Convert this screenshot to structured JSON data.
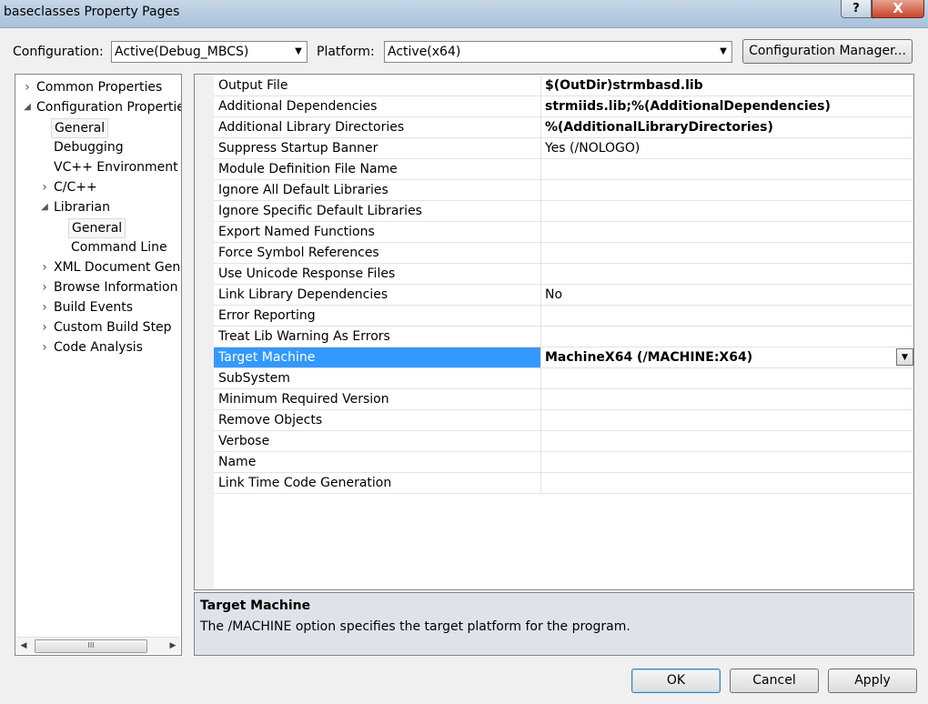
{
  "window": {
    "title": "baseclasses Property Pages",
    "help_label": "?",
    "close_label": "X"
  },
  "toolbar": {
    "configuration_label": "Configuration:",
    "configuration_value": "Active(Debug_MBCS)",
    "platform_label": "Platform:",
    "platform_value": "Active(x64)",
    "config_manager_label": "Configuration Manager..."
  },
  "tree": {
    "items": [
      {
        "label": "Common Properties",
        "expander": "›",
        "level": 0
      },
      {
        "label": "Configuration Propertie",
        "expander": "◢",
        "level": 0
      },
      {
        "label": "General",
        "expander": "",
        "level": 1
      },
      {
        "label": "Debugging",
        "expander": "",
        "level": 1
      },
      {
        "label": "VC++ Environment V",
        "expander": "",
        "level": 1
      },
      {
        "label": "C/C++",
        "expander": "›",
        "level": 1
      },
      {
        "label": "Librarian",
        "expander": "◢",
        "level": 1
      },
      {
        "label": "General",
        "expander": "",
        "level": 2
      },
      {
        "label": "Command Line",
        "expander": "",
        "level": 2
      },
      {
        "label": "XML Document Gene",
        "expander": "›",
        "level": 1
      },
      {
        "label": "Browse Information",
        "expander": "›",
        "level": 1
      },
      {
        "label": "Build Events",
        "expander": "›",
        "level": 1
      },
      {
        "label": "Custom Build Step",
        "expander": "›",
        "level": 1
      },
      {
        "label": "Code Analysis",
        "expander": "›",
        "level": 1
      }
    ],
    "scroll_thumb_label": "III"
  },
  "properties": [
    {
      "name": "Output File",
      "value": "$(OutDir)strmbasd.lib",
      "bold": true
    },
    {
      "name": "Additional Dependencies",
      "value": "strmiids.lib;%(AdditionalDependencies)",
      "bold": true
    },
    {
      "name": "Additional Library Directories",
      "value": "%(AdditionalLibraryDirectories)",
      "bold": true
    },
    {
      "name": "Suppress Startup Banner",
      "value": "Yes (/NOLOGO)",
      "bold": false
    },
    {
      "name": "Module Definition File Name",
      "value": "",
      "bold": false
    },
    {
      "name": "Ignore All Default Libraries",
      "value": "",
      "bold": false
    },
    {
      "name": "Ignore Specific Default Libraries",
      "value": "",
      "bold": false
    },
    {
      "name": "Export Named Functions",
      "value": "",
      "bold": false
    },
    {
      "name": "Force Symbol References",
      "value": "",
      "bold": false
    },
    {
      "name": "Use Unicode Response Files",
      "value": "",
      "bold": false
    },
    {
      "name": "Link Library Dependencies",
      "value": "No",
      "bold": false
    },
    {
      "name": "Error Reporting",
      "value": "",
      "bold": false
    },
    {
      "name": "Treat Lib Warning As Errors",
      "value": "",
      "bold": false
    },
    {
      "name": "Target Machine",
      "value": "MachineX64 (/MACHINE:X64)",
      "bold": true,
      "selected": true
    },
    {
      "name": "SubSystem",
      "value": "",
      "bold": false
    },
    {
      "name": "Minimum Required Version",
      "value": "",
      "bold": false
    },
    {
      "name": "Remove Objects",
      "value": "",
      "bold": false
    },
    {
      "name": "Verbose",
      "value": "",
      "bold": false
    },
    {
      "name": "Name",
      "value": "",
      "bold": false
    },
    {
      "name": "Link Time Code Generation",
      "value": "",
      "bold": false
    }
  ],
  "description": {
    "title": "Target Machine",
    "text": "The /MACHINE option specifies the target platform for the program."
  },
  "buttons": {
    "ok": "OK",
    "cancel": "Cancel",
    "apply": "Apply"
  },
  "colors": {
    "selection": "#3399ff"
  }
}
